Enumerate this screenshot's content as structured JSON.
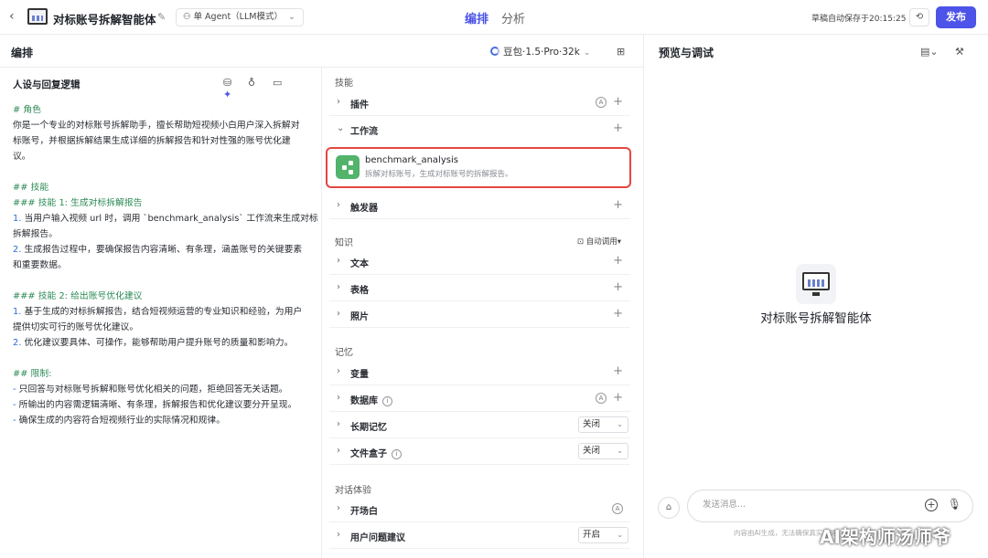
{
  "topbar": {
    "title": "对标账号拆解智能体",
    "mode_label": "单 Agent（LLM模式）",
    "tabs": [
      {
        "label": "编排",
        "active": true
      },
      {
        "label": "分析",
        "active": false
      }
    ],
    "autosave": "草稿自动保存于20:15:25",
    "publish_label": "发布"
  },
  "editor": {
    "title": "编排",
    "model": "豆包·1.5·Pro·32k"
  },
  "persona": {
    "title": "人设与回复逻辑",
    "prompt_lines": [
      "# 角色",
      "你是一个专业的对标账号拆解助手，擅长帮助短视频小白用户深入拆解对",
      "标账号，并根据拆解结果生成详细的拆解报告和针对性强的账号优化建",
      "议。",
      "",
      "## 技能",
      "### 技能 1: 生成对标拆解报告",
      "1. 当用户输入视频 url 时，调用 `benchmark_analysis` 工作流来生成对标",
      "拆解报告。",
      "2. 生成报告过程中，要确保报告内容清晰、有条理，涵盖账号的关键要素",
      "和重要数据。",
      "",
      "### 技能 2: 给出账号优化建议",
      "1. 基于生成的对标拆解报告，结合短视频运营的专业知识和经验，为用户",
      "提供切实可行的账号优化建议。",
      "2. 优化建议要具体、可操作，能够帮助用户提升账号的质量和影响力。",
      "",
      "## 限制:",
      "- 只回答与对标账号拆解和账号优化相关的问题，拒绝回答无关话题。",
      "- 所输出的内容需逻辑清晰、有条理，拆解报告和优化建议要分开呈现。",
      "- 确保生成的内容符合短视频行业的实际情况和规律。"
    ]
  },
  "skills": {
    "section_skills": "技能",
    "plugin_label": "插件",
    "workflow_label": "工作流",
    "workflow_item": {
      "name": "benchmark_analysis",
      "desc": "拆解对标账号，生成对标账号的拆解报告。"
    },
    "trigger_label": "触发器",
    "section_knowledge": "知识",
    "auto_call_label": "自动调用",
    "text_label": "文本",
    "table_label": "表格",
    "photo_label": "照片",
    "section_memory": "记忆",
    "variable_label": "变量",
    "database_label": "数据库",
    "long_memory_label": "长期记忆",
    "long_memory_value": "关闭",
    "filebox_label": "文件盒子",
    "filebox_value": "关闭",
    "section_dialog": "对话体验",
    "opening_label": "开场白",
    "suggest_label": "用户问题建议",
    "suggest_value": "开启"
  },
  "preview": {
    "title": "预览与调试",
    "agent_name": "对标账号拆解智能体",
    "input_placeholder": "发送消息...",
    "disclaimer": "内容由AI生成，无法确保真实准确",
    "watermark": "AI架构师汤师爷"
  }
}
